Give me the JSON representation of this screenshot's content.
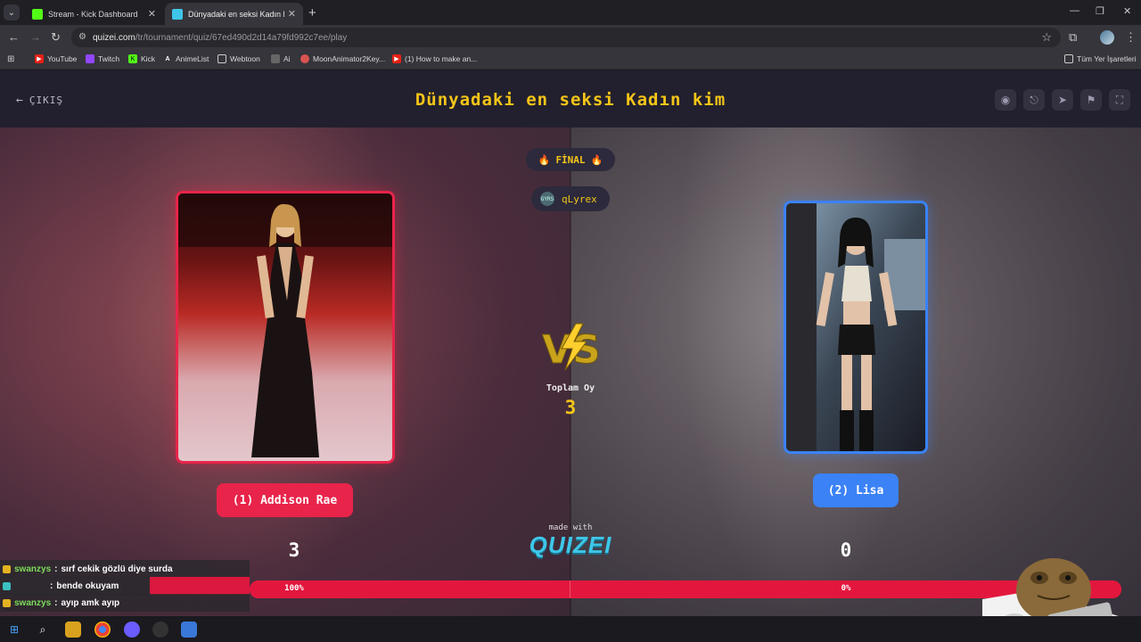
{
  "browser": {
    "tabs": [
      {
        "title": "Stream - Kick Dashboard",
        "active": false
      },
      {
        "title": "Dünyadaki en seksi Kadın kim -",
        "active": true
      }
    ],
    "url_host": "quizei.com",
    "url_path": "/tr/tournament/quiz/67ed490d2d14a79fd992c7ee/play",
    "bookmarks": [
      "YouTube",
      "Twitch",
      "Kick",
      "AnimeList",
      "Webtoon",
      "Ai",
      "MoonAnimator2Key...",
      "(1) How to make an..."
    ],
    "all_bookmarks_label": "Tüm Yer İşaretleri"
  },
  "quiz": {
    "exit_label": "ÇIKIŞ",
    "title": "Dünyadaki en seksi Kadın kim",
    "round_label": "FİNAL",
    "creator": "qLyrex",
    "creator_avatar_text": "GYRS",
    "total_votes_label": "Toplam Oy",
    "total_votes": "3",
    "made_with": "made with",
    "brand": "QUIZEI",
    "left": {
      "label": "(1) Addison Rae",
      "score": "3",
      "percent": "100%"
    },
    "right": {
      "label": "(2) Lisa",
      "score": "0",
      "percent": "0%"
    },
    "left_vote_fraction": 1.0
  },
  "chat": [
    {
      "user": "swanzys",
      "message": "sırf cekik gözlü diye surda"
    },
    {
      "user": "",
      "message": "bende okuyam"
    },
    {
      "user": "swanzys",
      "message": "ayıp amk ayıp"
    }
  ],
  "colors": {
    "accent_yellow": "#f5c518",
    "left_red": "#e8244a",
    "right_blue": "#3b82f6",
    "brand_cyan": "#3ec6e8"
  }
}
